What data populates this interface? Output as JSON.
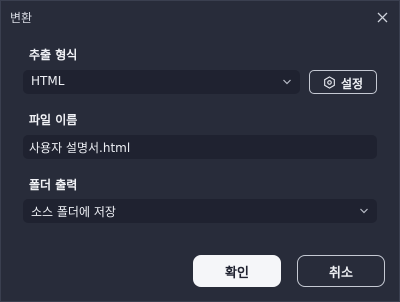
{
  "window": {
    "title": "변환",
    "close_icon": "close-icon"
  },
  "format": {
    "label": "추출 형식",
    "selected": "HTML",
    "settings_label": "설정",
    "settings_icon": "hexagon-settings-icon"
  },
  "filename": {
    "label": "파일 이름",
    "value": "사용자 설명서.html"
  },
  "output": {
    "label": "폴더 출력",
    "selected": "소스 폴더에 저장"
  },
  "buttons": {
    "ok_label": "확인",
    "cancel_label": "취소"
  },
  "colors": {
    "background": "#282c3a",
    "field": "#1f2230",
    "primary_button": "#f5f6f9"
  }
}
